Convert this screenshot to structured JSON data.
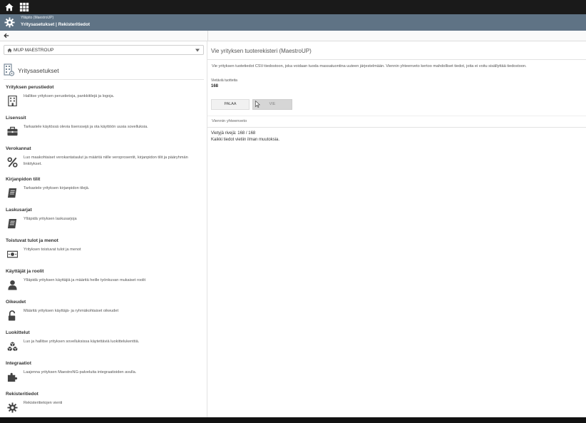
{
  "header": {
    "subtitle": "Ylläpito (MaestroUP)",
    "title": "Yritysasetukset | Rekisteritiedot"
  },
  "company_select": {
    "value": "MUP MAESTROUP"
  },
  "left_title": "Yritysasetukset",
  "sections": [
    {
      "title": "Yrityksen perustiedot",
      "desc": "Hallitse yrityksen perustietoja, pankkitilejä ja logoja.",
      "icon": "building-icon"
    },
    {
      "title": "Lisenssit",
      "desc": "Tarkastele käytössä olevia lisenssejä ja ota käyttöön uusia sovelluksia.",
      "icon": "briefcase-icon"
    },
    {
      "title": "Verokannat",
      "desc": "Luo maakohtaiset verokantataulut ja määritä niille veroprosentit, kirjanpidon tilit ja pääryhmän linkitykset.",
      "icon": "percent-icon"
    },
    {
      "title": "Kirjanpidon tilit",
      "desc": "Tarkastele yrityksen kirjanpidon tilejä.",
      "icon": "ledger-icon"
    },
    {
      "title": "Laskusarjat",
      "desc": "Ylläpidä yrityksen laskusarjoja",
      "icon": "invoice-book-icon"
    },
    {
      "title": "Toistuvat tulot ja menot",
      "desc": "Yrityksen toistuvat tulot ja menot",
      "icon": "money-icon"
    },
    {
      "title": "Käyttäjät ja roolit",
      "desc": "Ylläpidä yrityksen käyttäjiä ja määritä heille työnkuvan mukaiset roolit",
      "icon": "user-icon"
    },
    {
      "title": "Oikeudet",
      "desc": "Määritä yrityksen käyttäjä- ja ryhmäkohtaiset oikeudet",
      "icon": "unlock-icon"
    },
    {
      "title": "Luokittelut",
      "desc": "Luo ja hallitse yrityksen sovelluksissa käytettäviä luokittelukenttiä.",
      "icon": "cubes-icon"
    },
    {
      "title": "Integraatiot",
      "desc": "Laajenna yrityksen MaestroNG-palveluita integraatioiden avulla.",
      "icon": "puzzle-icon"
    },
    {
      "title": "Rekisteritiedot",
      "desc": "Rekisteritietojen vienti",
      "icon": "gear-icon"
    }
  ],
  "right": {
    "title": "Vie yrityksen tuoterekisteri (MaestroUP)",
    "desc": "Vie yrityksen tuotetiedot CSV-tiedostoon, joka voidaan tuoda massatuontina uuteen järjestelmään. Viennin yhteenveto kertoo mahdolliset tiedot, joita ei voitu sisällyttää tiedostoon.",
    "count_label": "Vietäviä tuotteita",
    "count": "168",
    "back_label": "PALAA",
    "export_label": "VIE",
    "summary_title": "Viennin yhteenveto",
    "rows_text": "Vietyjä rivejä: 168 / 168",
    "message": "Kaikki tiedot vietiin ilman muutoksia."
  },
  "colors": {
    "header_bg": "#5f7385",
    "topbar_bg": "#1a1a1a"
  }
}
